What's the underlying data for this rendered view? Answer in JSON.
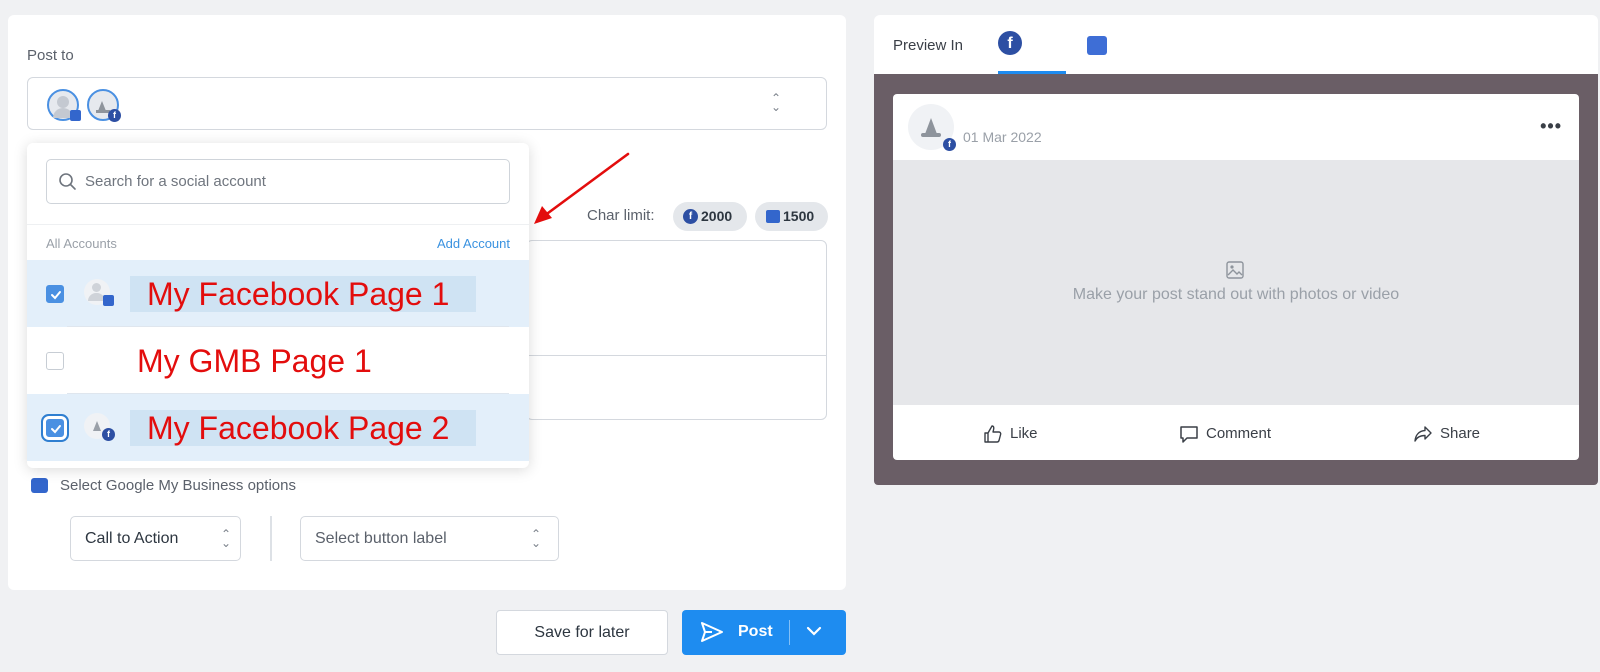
{
  "compose": {
    "post_to_label": "Post to",
    "char_limit_label": "Char limit:",
    "char_limits": {
      "facebook": "2000",
      "gmb": "1500"
    },
    "gmb_options_label": "Select Google My Business options",
    "call_to_action": "Call to Action",
    "button_label_placeholder": "Select button label",
    "save_for_later": "Save for later",
    "post": "Post"
  },
  "dropdown": {
    "search_placeholder": "Search for a social account",
    "all_accounts": "All Accounts",
    "add_account": "Add Account",
    "accounts": [
      {
        "name": "My Facebook Page 1",
        "checked": true
      },
      {
        "name": "My GMB Page 1",
        "checked": false
      },
      {
        "name": "My Facebook Page 2",
        "checked": true
      }
    ]
  },
  "preview": {
    "title": "Preview In",
    "date": "01 Mar 2022",
    "media_prompt": "Make your post stand out with photos or video",
    "actions": {
      "like": "Like",
      "comment": "Comment",
      "share": "Share"
    },
    "more_glyph": "•••"
  },
  "colors": {
    "primary": "#1e8cf0",
    "facebook": "#2d4fa3",
    "gmb": "#3366cc",
    "annotation": "#e30d0d"
  }
}
